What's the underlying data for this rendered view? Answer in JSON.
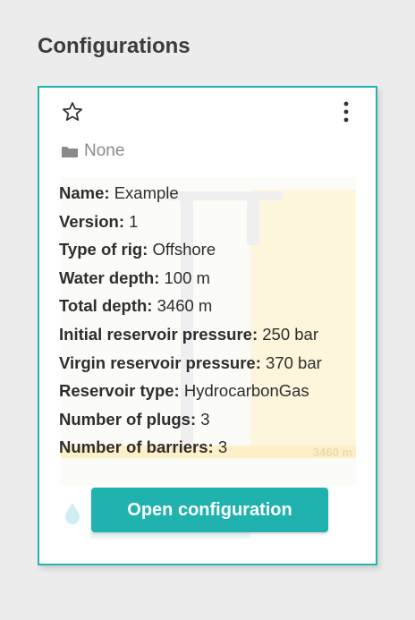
{
  "section": {
    "title": "Configurations"
  },
  "card": {
    "folder": "None",
    "fields": [
      {
        "label": "Name:",
        "value": "Example"
      },
      {
        "label": "Version:",
        "value": "1"
      },
      {
        "label": "Type of rig:",
        "value": "Offshore"
      },
      {
        "label": "Water depth:",
        "value": "100 m"
      },
      {
        "label": "Total depth:",
        "value": "3460 m"
      },
      {
        "label": "Initial reservoir pressure:",
        "value": "250 bar"
      },
      {
        "label": "Virgin reservoir pressure:",
        "value": "370 bar"
      },
      {
        "label": "Reservoir type:",
        "value": "HydrocarbonGas"
      },
      {
        "label": "Number of plugs:",
        "value": "3"
      },
      {
        "label": "Number of barriers:",
        "value": "3"
      }
    ],
    "preview_depth_label": "3460 m",
    "open_button_label": "Open configuration",
    "icons": {
      "favorite": "star-outline-icon",
      "menu": "more-vertical-icon",
      "folder": "folder-icon",
      "fluid": "water-drop-icon"
    }
  },
  "colors": {
    "accent": "#1fb2ae",
    "card_border": "#24b3b0",
    "background": "#ececec"
  }
}
